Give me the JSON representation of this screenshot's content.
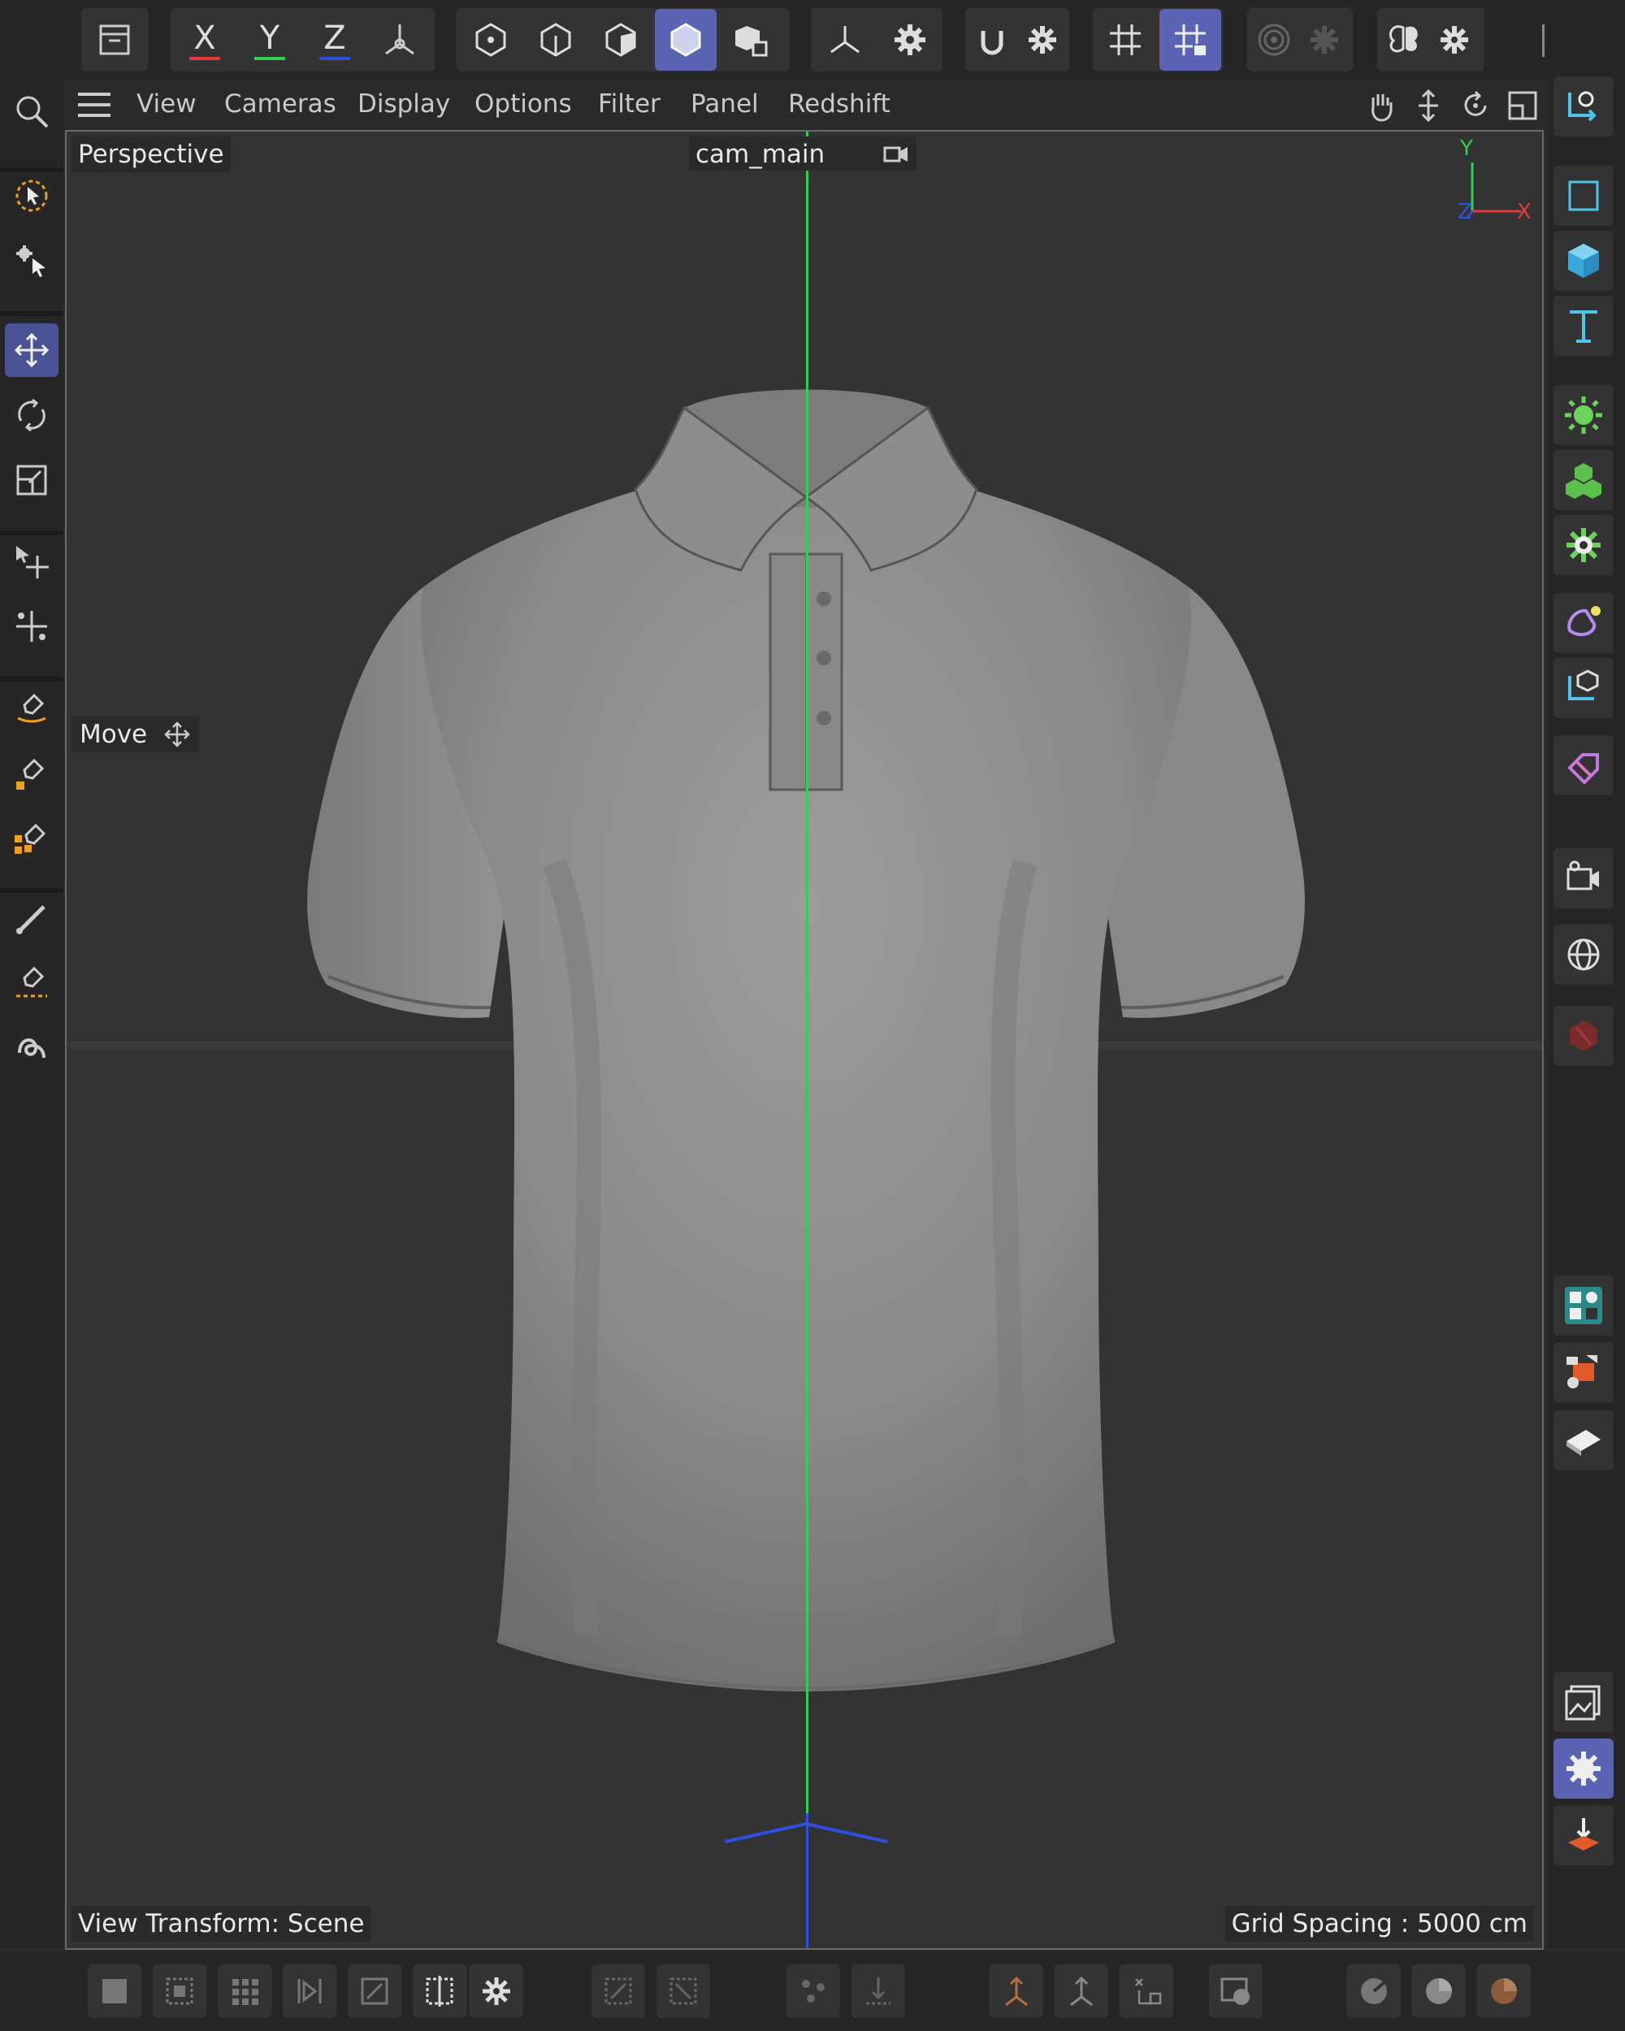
{
  "toolbar": {
    "axis_x": "X",
    "axis_y": "Y",
    "axis_z": "Z"
  },
  "menu": {
    "items": [
      "View",
      "Cameras",
      "Display",
      "Options",
      "Filter",
      "Panel",
      "Redshift"
    ]
  },
  "viewport": {
    "view_name": "Perspective",
    "camera": "cam_main",
    "tool_label": "Move",
    "view_transform": "View Transform: Scene",
    "grid_spacing": "Grid Spacing : 5000 cm",
    "gizmo_y": "Y",
    "gizmo_x": "X",
    "gizmo_z": "Z"
  },
  "colors": {
    "accent": "#5a63b4",
    "axis_x": "#e23b3b",
    "axis_y": "#2fcf53",
    "axis_z": "#2f4fe0",
    "model": "#8c8c8c"
  }
}
